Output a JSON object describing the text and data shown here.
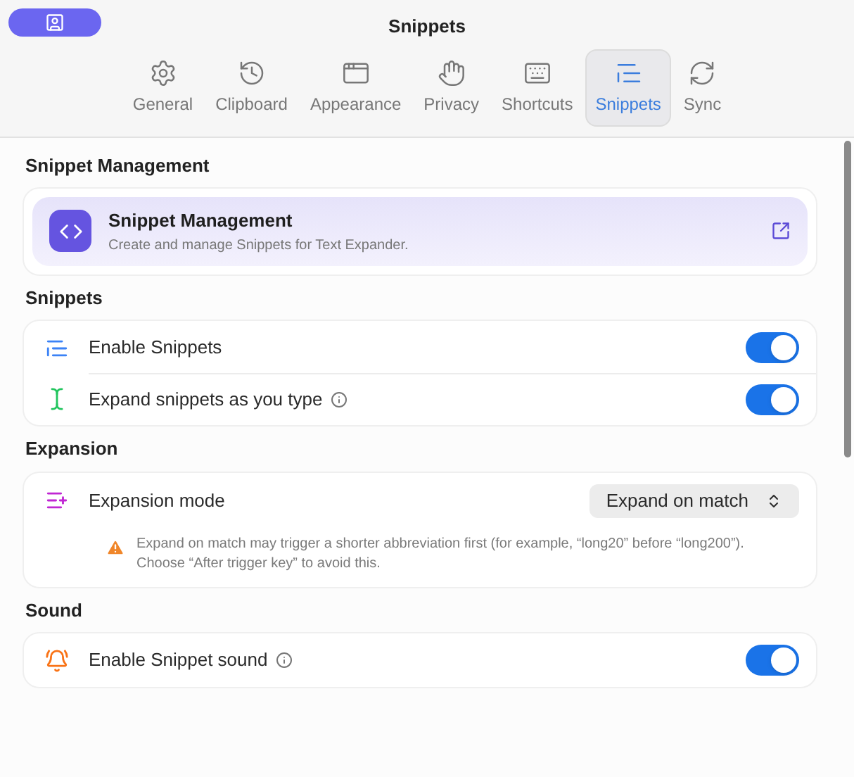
{
  "window": {
    "title": "Snippets"
  },
  "tabs": [
    {
      "label": "General",
      "selected": false
    },
    {
      "label": "Clipboard",
      "selected": false
    },
    {
      "label": "Appearance",
      "selected": false
    },
    {
      "label": "Privacy",
      "selected": false
    },
    {
      "label": "Shortcuts",
      "selected": false
    },
    {
      "label": "Snippets",
      "selected": true
    },
    {
      "label": "Sync",
      "selected": false
    }
  ],
  "sections": [
    {
      "title": "Snippet Management",
      "rows": [
        {
          "kind": "link",
          "label": "Snippet Management",
          "description": "Create and manage Snippets for Text Expander."
        }
      ]
    },
    {
      "title": "Snippets",
      "rows": [
        {
          "kind": "toggle",
          "label": "Enable Snippets",
          "info": false,
          "on": true
        },
        {
          "kind": "toggle",
          "label": "Expand snippets as you type",
          "info": true,
          "on": true
        }
      ]
    },
    {
      "title": "Expansion",
      "rows": [
        {
          "kind": "select",
          "label": "Expansion mode",
          "value": "Expand on match"
        },
        {
          "kind": "warning",
          "label": "Expand on match may trigger a shorter abbreviation first (for example, “long20” before “long200”). Choose “After trigger key” to avoid this."
        }
      ]
    },
    {
      "title": "Sound",
      "rows": [
        {
          "kind": "toggle",
          "label": "Enable Snippet sound",
          "info": true,
          "on": true
        }
      ]
    }
  ]
}
